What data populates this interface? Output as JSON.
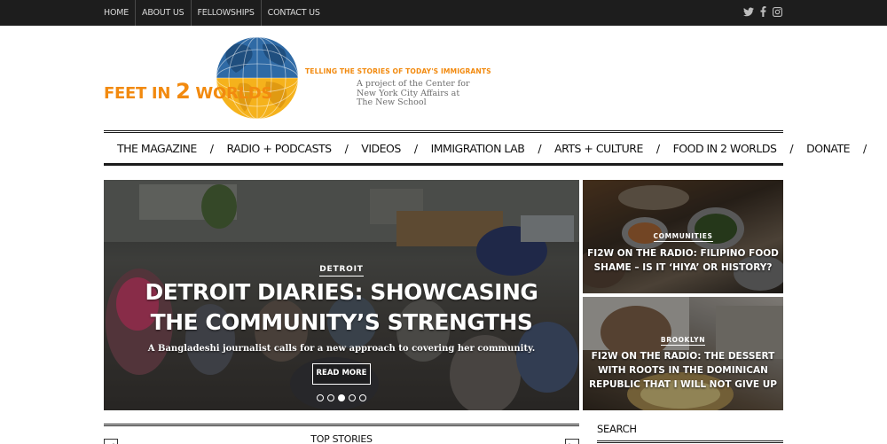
{
  "topbar": {
    "nav": [
      "HOME",
      "ABOUT US",
      "FELLOWSHIPS",
      "CONTACT US"
    ],
    "social": [
      "twitter-icon",
      "facebook-icon",
      "instagram-icon"
    ]
  },
  "logo": {
    "title_a": "FEET IN ",
    "title_b": "2",
    "title_c": " WORLDS",
    "tagline": "TELLING THE STORIES OF TODAY'S IMMIGRANTS",
    "sub": [
      "A project of the Center for",
      "New York City Affairs at",
      "The New School"
    ]
  },
  "mainnav": [
    "THE MAGAZINE",
    "RADIO + PODCASTS",
    "VIDEOS",
    "IMMIGRATION LAB",
    "ARTS + CULTURE",
    "FOOD IN 2 WORLDS",
    "DONATE"
  ],
  "hero": {
    "category": "DETROIT",
    "headline": "DETROIT DIARIES: SHOWCASING THE COMMUNITY’S STRENGTHS",
    "dek": "A Bangladeshi journalist calls for a new approach to covering her community.",
    "button": "READ MORE",
    "slides": 5,
    "active_slide": 3
  },
  "cards": [
    {
      "category": "COMMUNITIES",
      "title": "FI2W ON THE RADIO: FILIPINO FOOD SHAME – IS IT ‘HIYA’ OR HISTORY?"
    },
    {
      "category": "BROOKLYN",
      "title": "FI2W ON THE RADIO: THE DESSERT WITH ROOTS IN THE DOMINICAN REPUBLIC THAT I WILL NOT GIVE UP"
    }
  ],
  "topstories": {
    "label": "TOP STORIES",
    "prev": "◀",
    "next": "▶"
  },
  "search": {
    "label": "SEARCH"
  },
  "colors": {
    "brand_orange": "#f28a0f",
    "topbar": "#1d1d1d",
    "globe_blue": "#2f6aa5",
    "globe_gold": "#f5b21c"
  }
}
